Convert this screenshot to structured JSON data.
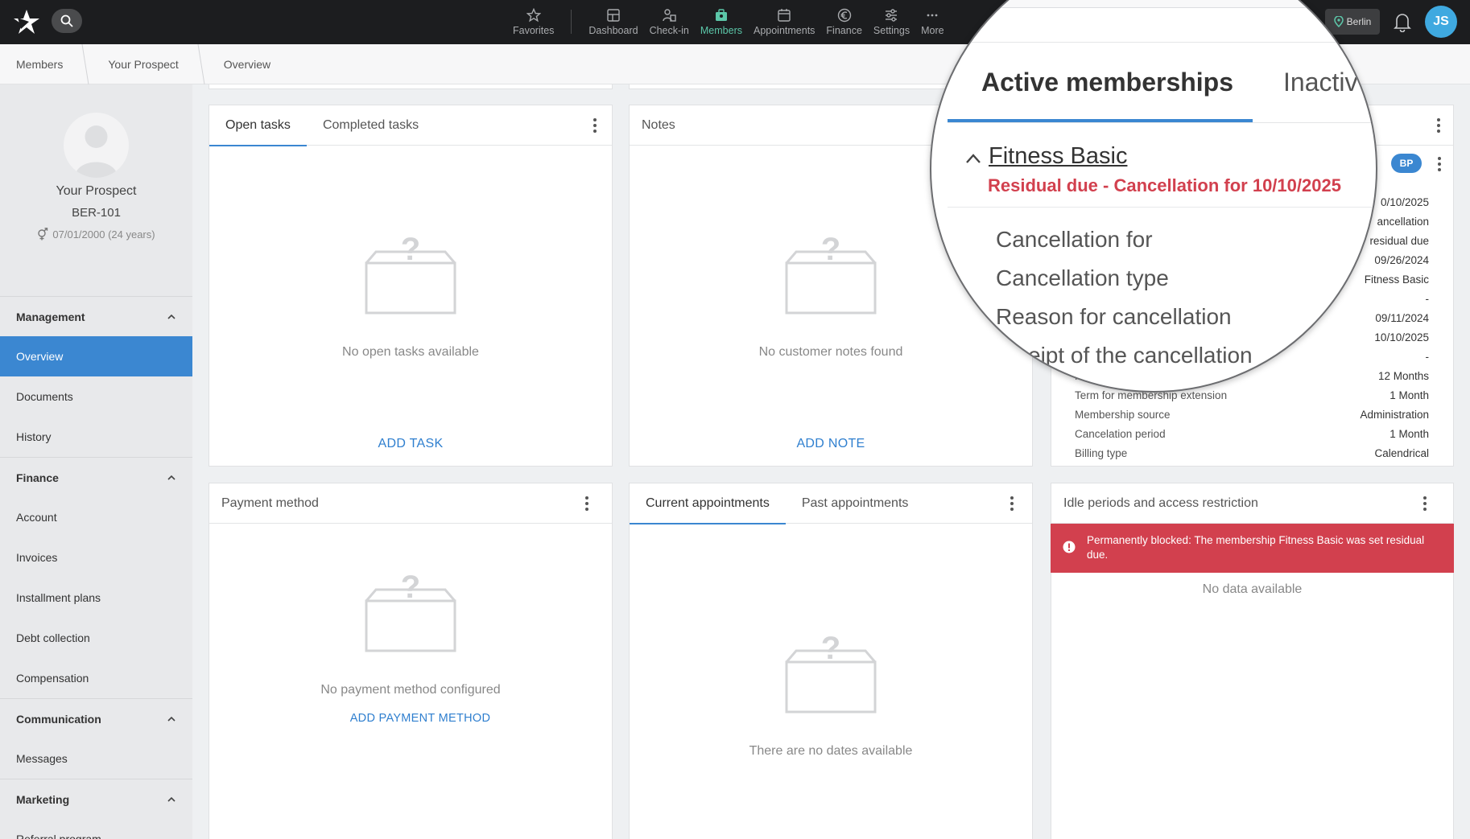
{
  "nav": {
    "items": [
      {
        "label": "Favorites",
        "icon": "star-icon"
      },
      {
        "label": "Dashboard",
        "icon": "dashboard-icon"
      },
      {
        "label": "Check-in",
        "icon": "check-in-icon"
      },
      {
        "label": "Members",
        "icon": "members-icon"
      },
      {
        "label": "Appointments",
        "icon": "calendar-icon"
      },
      {
        "label": "Finance",
        "icon": "euro-icon"
      },
      {
        "label": "Settings",
        "icon": "sliders-icon"
      },
      {
        "label": "More",
        "icon": "more-icon"
      }
    ],
    "active": "Members",
    "location": "Berlin",
    "user_initials": "JS"
  },
  "breadcrumb": [
    "Members",
    "Your Prospect",
    "Overview"
  ],
  "profile": {
    "name": "Your Prospect",
    "id": "BER-101",
    "dob": "07/01/2000 (24 years)"
  },
  "sidebar": {
    "management": {
      "title": "Management",
      "items": [
        "Overview",
        "Documents",
        "History"
      ]
    },
    "finance": {
      "title": "Finance",
      "items": [
        "Account",
        "Invoices",
        "Installment plans",
        "Debt collection",
        "Compensation"
      ]
    },
    "communication": {
      "title": "Communication",
      "items": [
        "Messages"
      ]
    },
    "marketing": {
      "title": "Marketing",
      "items": [
        "Referral program"
      ]
    }
  },
  "tasks": {
    "tabs": [
      "Open tasks",
      "Completed tasks"
    ],
    "empty": "No open tasks available",
    "action": "ADD TASK"
  },
  "notes": {
    "title": "Notes",
    "empty": "No customer notes found",
    "action": "ADD NOTE"
  },
  "payment": {
    "title": "Payment method",
    "empty": "No payment method configured",
    "action": "ADD PAYMENT METHOD"
  },
  "appointments": {
    "tabs": [
      "Current appointments",
      "Past appointments"
    ],
    "empty": "There are no dates available"
  },
  "idle": {
    "title": "Idle periods and access restriction",
    "alert": "Permanently blocked: The membership Fitness Basic was set residual due.",
    "empty": "No data available"
  },
  "membership": {
    "badge": "BP",
    "rows": [
      {
        "label": "",
        "value": "0/10/2025"
      },
      {
        "label": "",
        "value": "ancellation"
      },
      {
        "label": "",
        "value": "residual due"
      },
      {
        "label": "",
        "value": "09/26/2024"
      },
      {
        "label": "",
        "value": "Fitness Basic"
      },
      {
        "label": "",
        "value": "-"
      },
      {
        "label": "",
        "value": "09/11/2024"
      },
      {
        "label": "",
        "value": "10/10/2025"
      },
      {
        "label": "",
        "value": "-"
      },
      {
        "label": "Membe",
        "value": "12 Months"
      },
      {
        "label": "Term for membership extension",
        "value": "1 Month"
      },
      {
        "label": "Membership source",
        "value": "Administration"
      },
      {
        "label": "Cancelation period",
        "value": "1 Month"
      },
      {
        "label": "Billing type",
        "value": "Calendrical"
      }
    ]
  },
  "magnifier": {
    "tab_active": "Active memberships",
    "tab_inactive": "Inactiv",
    "title": "Fitness Basic",
    "status": "Residual due - Cancellation for 10/10/2025",
    "labels": [
      "Cancellation for",
      "Cancellation type",
      "Reason for cancellation",
      "eipt of the cancellation"
    ]
  }
}
